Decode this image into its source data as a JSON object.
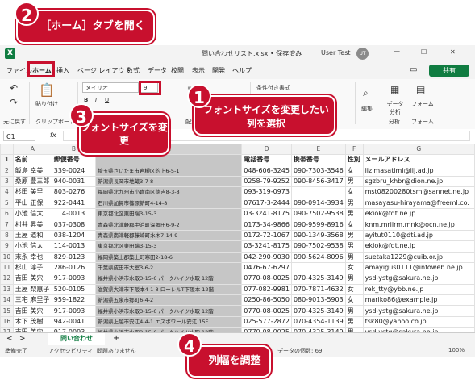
{
  "titlebar": {
    "file": "問い合わせリスト.xlsx • 保存済み",
    "user": "User Test",
    "avatar": "UT"
  },
  "menu": [
    "ファイル",
    "ホーム",
    "挿入",
    "ページ レイアウト",
    "数式",
    "データ",
    "校閲",
    "表示",
    "開発",
    "ヘルプ"
  ],
  "ribbon": {
    "undo": "元に戻す",
    "paste": "貼り付け",
    "clipboard": "クリップボード",
    "font_name": "メイリオ",
    "font_size": "9",
    "conditional": "条件付き書式",
    "haichi": "配置",
    "edit": "編集",
    "analyze": "データ分析",
    "analysis": "分析",
    "form": "フォーム",
    "share": "共有"
  },
  "formula": {
    "cell": "C1",
    "fx": "fx"
  },
  "columns": [
    "A",
    "B",
    "C",
    "D",
    "E",
    "F",
    "G"
  ],
  "rows": [
    {
      "n": "1",
      "a": "名前",
      "b": "郵便番号",
      "c": "",
      "d": "電話番号",
      "e": "携帯番号",
      "f": "性別",
      "g": "メールアドレス"
    },
    {
      "n": "2",
      "a": "飯島 幸美",
      "b": "339-0024",
      "c": "埼玉県さいたま市岩槻区的上6-5-1",
      "d": "048-606-3245",
      "e": "090-7303-3546",
      "f": "女",
      "g": "iizimasatimi@iij.ad.jp"
    },
    {
      "n": "3",
      "a": "桑原 豊三郎",
      "b": "940-0031",
      "c": "新潟県長岡市地蔵3-7-8",
      "d": "0258-79-9252",
      "e": "090-8456-3417",
      "f": "男",
      "g": "sgzbru_khbr@dion.ne.jp"
    },
    {
      "n": "4",
      "a": "杉田 美里",
      "b": "803-0276",
      "c": "福岡県北九州市小倉南区徳吉8-3-8",
      "d": "093-319-0973",
      "e": "",
      "f": "女",
      "g": "mst08200280tsm@sannet.ne.jp"
    },
    {
      "n": "5",
      "a": "平山 正保",
      "b": "922-0441",
      "c": "石川県加賀市篠原新町4-14-8",
      "d": "07617-3-2444",
      "e": "090-0914-3934",
      "f": "男",
      "g": "masayasu-hirayama@freeml.co."
    },
    {
      "n": "6",
      "a": "小池 信太",
      "b": "114-0013",
      "c": "東京都北区東田端3-15-3",
      "d": "03-3241-8175",
      "e": "090-7502-9538",
      "f": "男",
      "g": "ekiok@fdt.ne.jp"
    },
    {
      "n": "7",
      "a": "村井 昇美",
      "b": "037-0308",
      "c": "青森県北津軽郡中泊町深郷田6-9-2",
      "d": "0173-34-9866",
      "e": "090-9599-8916",
      "f": "女",
      "g": "knm.mriirm.mnk@ocn.ne.jp"
    },
    {
      "n": "8",
      "a": "土屋 道和",
      "b": "038-1204",
      "c": "青森県南津軽郡藤崎町水木7-14-9",
      "d": "0172-72-1067",
      "e": "090-1349-3568",
      "f": "男",
      "g": "ayitut0110@dti.ad.jp"
    },
    {
      "n": "9",
      "a": "小池 信太",
      "b": "114-0013",
      "c": "東京都北区東田端3-15-3",
      "d": "03-3241-8175",
      "e": "090-7502-9538",
      "f": "男",
      "g": "ekiok@fdt.ne.jp"
    },
    {
      "n": "10",
      "a": "末永 幸也",
      "b": "829-0123",
      "c": "福岡県築上郡築上町寒田2-18-6",
      "d": "042-290-9030",
      "e": "090-5624-8096",
      "f": "男",
      "g": "suetaka1229@cuib.or.jp"
    },
    {
      "n": "11",
      "a": "杉山 淳子",
      "b": "286-0126",
      "c": "千葉県成田市大室3-6-2",
      "d": "0476-67-6297",
      "e": "",
      "f": "女",
      "g": "amayigus0111@infoweb.ne.jp"
    },
    {
      "n": "12",
      "a": "吉田 美穴",
      "b": "917-0093",
      "c": "福井県小浜市水取3-15-6 パークハイツ水取 12階",
      "d": "0770-08-0025",
      "e": "070-4325-3149",
      "f": "男",
      "g": "ysd-ystg@sakura.ne.jp"
    },
    {
      "n": "13",
      "a": "土屋 梨恵子",
      "b": "520-0105",
      "c": "滋賀県大津市下阪本4-1-8 ローレルT下阪本 12階",
      "d": "077-082-9981",
      "e": "070-7871-4632",
      "f": "女",
      "g": "rek_tty@ybb.ne.jp"
    },
    {
      "n": "14",
      "a": "三宅 麻里子",
      "b": "959-1822",
      "c": "新潟県五泉市郷町6-4-2",
      "d": "0250-86-5050",
      "e": "080-9013-5903",
      "f": "女",
      "g": "mariko86@example.jp"
    },
    {
      "n": "15",
      "a": "吉田 美穴",
      "b": "917-0093",
      "c": "福井県小浜市水取3-15-6 パークハイツ水取 12階",
      "d": "0770-08-0025",
      "e": "070-4325-3149",
      "f": "男",
      "g": "ysd-ystg@sakura.ne.jp"
    },
    {
      "n": "16",
      "a": "木下 茂樹",
      "b": "942-0041",
      "c": "新潟県上越市安江4-4-1 エスポワール安江 15F",
      "d": "025-577-2872",
      "e": "070-4354-1139",
      "f": "男",
      "g": "tsk80@yahoo.co.jp"
    },
    {
      "n": "17",
      "a": "吉田 美穴",
      "b": "917-0093",
      "c": "福井県小浜市水取3-15-6 パークハイツ水取 12階",
      "d": "0770-08-0025",
      "e": "070-4325-3149",
      "f": "男",
      "g": "ysd-ystg@sakura.ne.jp"
    },
    {
      "n": "18",
      "a": "木村 智治",
      "b": "811-4343",
      "c": "福岡県遠賀郡遠賀町田隅2-11-9",
      "d": "093-020-9083",
      "e": "090-5200-2534",
      "f": "男",
      "g": "tomoharu@example.ad.jp"
    }
  ],
  "sheet_tab": "問い合わせ",
  "status": {
    "ready": "準備完了",
    "accessibility": "アクセシビリティ: 問題ありません",
    "count": "データの個数: 69",
    "zoom": "100%"
  },
  "callouts": {
    "c1": "フォントサイズを変更したい列を選択",
    "c2": "［ホーム］タブを開く",
    "c3": "フォントサイズを変更",
    "c4": "列幅を調整",
    "n1": "1",
    "n2": "2",
    "n3": "3",
    "n4": "4"
  },
  "colors": {
    "accent": "#c8102e",
    "excel_green": "#107c41"
  }
}
